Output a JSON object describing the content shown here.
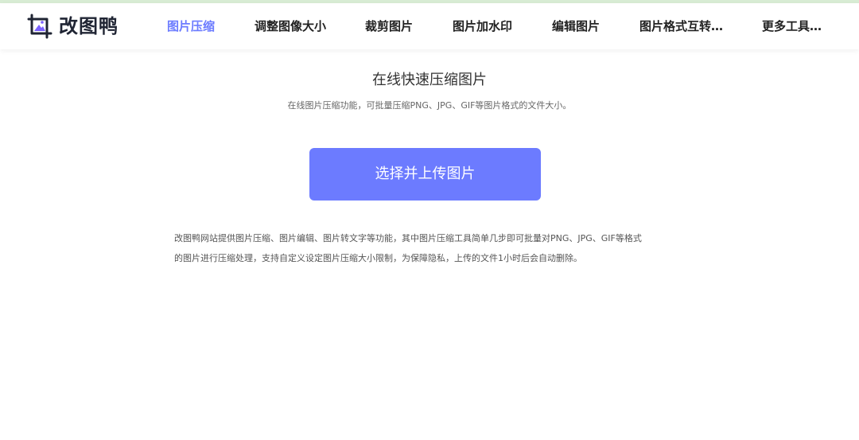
{
  "brand": {
    "name": "改图鸭",
    "accent": "#6b7bff",
    "icon": "image-crop-icon"
  },
  "nav": {
    "items": [
      {
        "label": "图片压缩",
        "active": true
      },
      {
        "label": "调整图像大小"
      },
      {
        "label": "裁剪图片"
      },
      {
        "label": "图片加水印"
      },
      {
        "label": "编辑图片"
      },
      {
        "label": "图片格式互转…"
      },
      {
        "label": "更多工具…"
      }
    ]
  },
  "hero": {
    "title": "在线快速压缩图片",
    "subtitle": "在线图片压缩功能，可批量压缩PNG、JPG、GIF等图片格式的文件大小。",
    "upload_label": "选择并上传图片",
    "button_color": "#6c7bff"
  },
  "description": {
    "line1": "改图鸭网站提供图片压缩、图片编辑、图片转文字等功能，其中图片压缩工具简单几步即可批量对PNG、JPG、GIF等格式",
    "line2": "的图片进行压缩处理，支持自定义设定图片压缩大小限制，为保障隐私，上传的文件1小时后会自动删除。"
  }
}
